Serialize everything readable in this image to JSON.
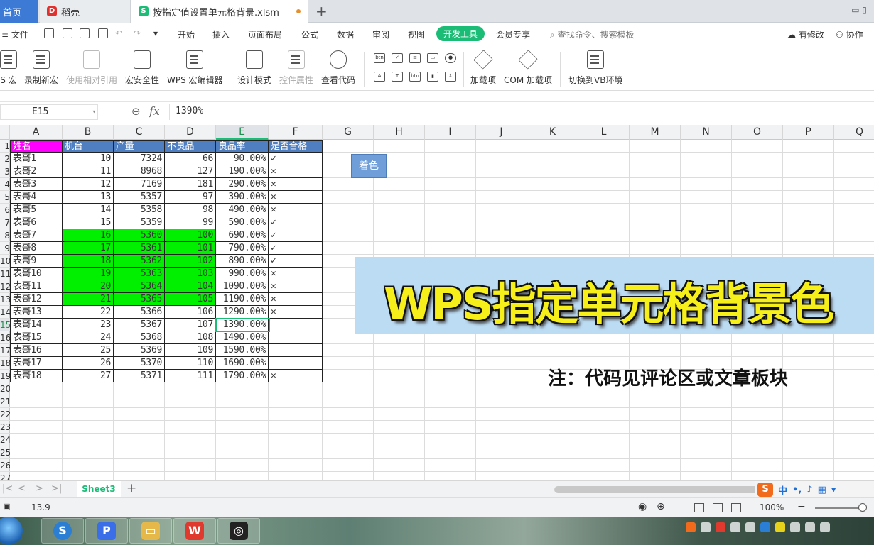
{
  "title_bar": {
    "home_tab": "首页",
    "tabs": [
      {
        "label": "稻壳"
      },
      {
        "label": "按指定值设置单元格背景.xlsm"
      }
    ]
  },
  "menu": {
    "file": "文件",
    "items": [
      "开始",
      "插入",
      "页面布局",
      "公式",
      "数据",
      "审阅",
      "视图",
      "开发工具",
      "会员专享"
    ],
    "active": "开发工具",
    "search_placeholder": "查找命令、搜索模板",
    "right": [
      "有修改",
      "协作"
    ]
  },
  "ribbon": {
    "buttons": [
      {
        "label": "S 宏",
        "disabled": false
      },
      {
        "label": "录制新宏",
        "disabled": false
      },
      {
        "label": "使用相对引用",
        "disabled": true
      },
      {
        "label": "宏安全性",
        "disabled": false
      },
      {
        "label": "WPS 宏编辑器",
        "disabled": false
      },
      {
        "label": "设计模式",
        "disabled": false
      },
      {
        "label": "控件属性",
        "disabled": true
      },
      {
        "label": "查看代码",
        "disabled": false
      },
      {
        "label": "加载项",
        "disabled": false
      },
      {
        "label": "COM 加载项",
        "disabled": false
      },
      {
        "label": "切换到VB环境",
        "disabled": false
      }
    ]
  },
  "formula_bar": {
    "cell_ref": "E15",
    "fx": "fx",
    "value": "1390%"
  },
  "sheet": {
    "columns": [
      "A",
      "B",
      "C",
      "D",
      "E",
      "F",
      "G",
      "H",
      "I",
      "J",
      "K",
      "L",
      "M",
      "N",
      "O",
      "P",
      "Q"
    ],
    "selected_column": "E",
    "row_numbers": [
      "1",
      "2",
      "3",
      "4",
      "5",
      "6",
      "7",
      "8",
      "9",
      "10",
      "11",
      "12",
      "13",
      "14",
      "15",
      "16",
      "17",
      "18",
      "19",
      "20",
      "21",
      "22",
      "23",
      "24",
      "25",
      "26",
      "27"
    ],
    "selected_row": "15",
    "headers": [
      "姓名",
      "机台",
      "产量",
      "不良品",
      "良品率",
      "是否合格"
    ],
    "rows": [
      {
        "name": "表哥1",
        "machine": "10",
        "output": "7324",
        "defects": "66",
        "rate": "90.00%",
        "pass": "✓",
        "green": false
      },
      {
        "name": "表哥2",
        "machine": "11",
        "output": "8968",
        "defects": "127",
        "rate": "190.00%",
        "pass": "✕",
        "green": false
      },
      {
        "name": "表哥3",
        "machine": "12",
        "output": "7169",
        "defects": "181",
        "rate": "290.00%",
        "pass": "✕",
        "green": false
      },
      {
        "name": "表哥4",
        "machine": "13",
        "output": "5357",
        "defects": "97",
        "rate": "390.00%",
        "pass": "✕",
        "green": false
      },
      {
        "name": "表哥5",
        "machine": "14",
        "output": "5358",
        "defects": "98",
        "rate": "490.00%",
        "pass": "✕",
        "green": false
      },
      {
        "name": "表哥6",
        "machine": "15",
        "output": "5359",
        "defects": "99",
        "rate": "590.00%",
        "pass": "✓",
        "green": false
      },
      {
        "name": "表哥7",
        "machine": "16",
        "output": "5360",
        "defects": "100",
        "rate": "690.00%",
        "pass": "✓",
        "green": true
      },
      {
        "name": "表哥8",
        "machine": "17",
        "output": "5361",
        "defects": "101",
        "rate": "790.00%",
        "pass": "✓",
        "green": true
      },
      {
        "name": "表哥9",
        "machine": "18",
        "output": "5362",
        "defects": "102",
        "rate": "890.00%",
        "pass": "✓",
        "green": true
      },
      {
        "name": "表哥10",
        "machine": "19",
        "output": "5363",
        "defects": "103",
        "rate": "990.00%",
        "pass": "✕",
        "green": true
      },
      {
        "name": "表哥11",
        "machine": "20",
        "output": "5364",
        "defects": "104",
        "rate": "1090.00%",
        "pass": "✕",
        "green": true
      },
      {
        "name": "表哥12",
        "machine": "21",
        "output": "5365",
        "defects": "105",
        "rate": "1190.00%",
        "pass": "✕",
        "green": true
      },
      {
        "name": "表哥13",
        "machine": "22",
        "output": "5366",
        "defects": "106",
        "rate": "1290.00%",
        "pass": "✕",
        "green": false
      },
      {
        "name": "表哥14",
        "machine": "23",
        "output": "5367",
        "defects": "107",
        "rate": "1390.00%",
        "pass": "",
        "green": false
      },
      {
        "name": "表哥15",
        "machine": "24",
        "output": "5368",
        "defects": "108",
        "rate": "1490.00%",
        "pass": "",
        "green": false
      },
      {
        "name": "表哥16",
        "machine": "25",
        "output": "5369",
        "defects": "109",
        "rate": "1590.00%",
        "pass": "",
        "green": false
      },
      {
        "name": "表哥17",
        "machine": "26",
        "output": "5370",
        "defects": "110",
        "rate": "1690.00%",
        "pass": "",
        "green": false
      },
      {
        "name": "表哥18",
        "machine": "27",
        "output": "5371",
        "defects": "111",
        "rate": "1790.00%",
        "pass": "✕",
        "green": false
      }
    ],
    "color_button": "着色",
    "banner_title": "WPS指定单元格背景色",
    "note": "注：代码见评论区或文章板块"
  },
  "sheet_tabs": {
    "active": "Sheet3"
  },
  "ime": {
    "label": "中"
  },
  "status_bar": {
    "value": "13.9",
    "zoom": "100%"
  },
  "colors": {
    "accent": "#1bbd76",
    "header_blue": "#4f7fc0",
    "header_pink": "#ff00ff",
    "highlight_green": "#00f000",
    "banner_bg": "#bcdcf4",
    "banner_text": "#f7ef1a"
  }
}
